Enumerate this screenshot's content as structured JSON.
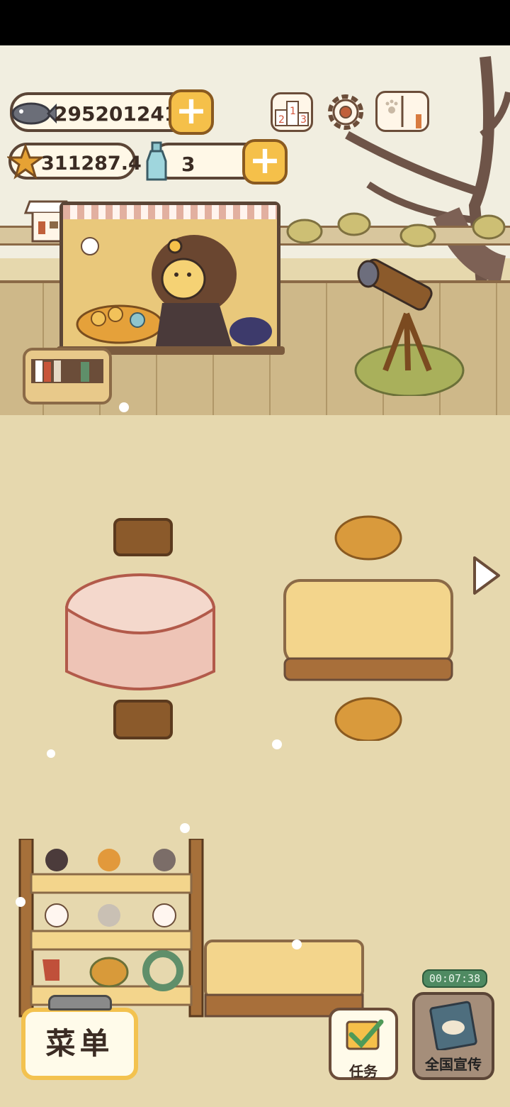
{
  "currency": {
    "fish": "295201241",
    "star": "311287.4",
    "bottle": "3"
  },
  "buttons": {
    "menu": "菜单",
    "tasks": "任务",
    "promotion": "全国宣传"
  },
  "promotion_timer": "00:07:38",
  "icons": [
    "fish-icon",
    "star-icon",
    "bottle-icon",
    "ranking-icon",
    "settings-gear-icon",
    "catbook-icon",
    "shop-icon",
    "next-arrow-icon",
    "task-check-icon",
    "promotion-poster-icon"
  ]
}
